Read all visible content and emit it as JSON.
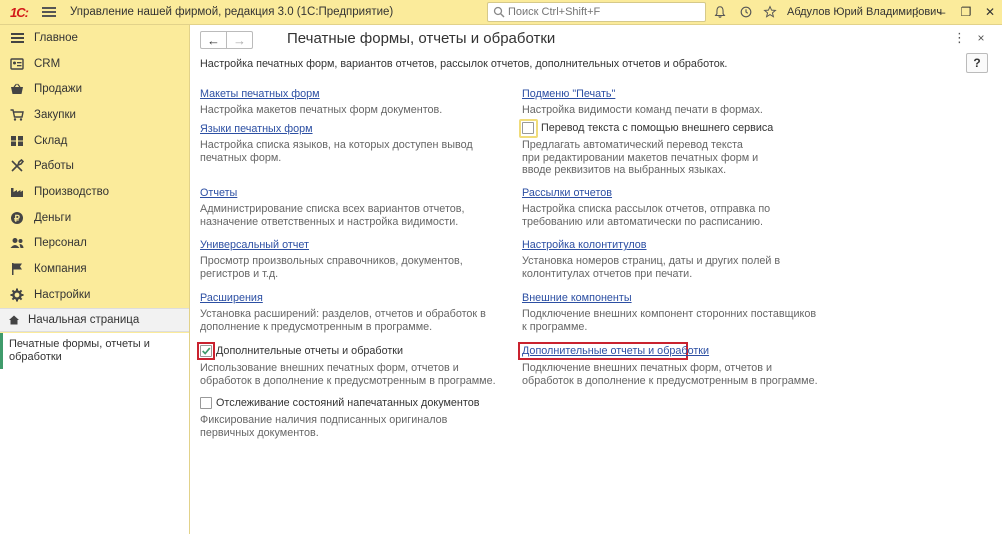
{
  "titlebar": {
    "logo": "1С:",
    "title": "Управление нашей фирмой, редакция 3.0  (1С:Предприятие)",
    "search_placeholder": "Поиск Ctrl+Shift+F",
    "user": "Абдулов Юрий Владимирович",
    "more": "⋮",
    "minimize": "‒",
    "restore": "❐",
    "close": "✕"
  },
  "sidebar": {
    "items": [
      {
        "label": "Главное",
        "icon": "menu-lines-icon"
      },
      {
        "label": "CRM",
        "icon": "crm-card-icon"
      },
      {
        "label": "Продажи",
        "icon": "basket-icon"
      },
      {
        "label": "Закупки",
        "icon": "cart-icon"
      },
      {
        "label": "Склад",
        "icon": "warehouse-icon"
      },
      {
        "label": "Работы",
        "icon": "tools-icon"
      },
      {
        "label": "Производство",
        "icon": "factory-icon"
      },
      {
        "label": "Деньги",
        "icon": "coin-icon"
      },
      {
        "label": "Персонал",
        "icon": "people-icon"
      },
      {
        "label": "Компания",
        "icon": "flag-icon"
      },
      {
        "label": "Настройки",
        "icon": "gear-icon"
      }
    ],
    "start_page": "Начальная страница",
    "open_form": "Печатные формы, отчеты и обработки"
  },
  "main": {
    "title": "Печатные формы, отчеты и обработки",
    "back": "←",
    "forward": "→",
    "more": "⋮",
    "close": "×",
    "help": "?",
    "description": "Настройка печатных форм, вариантов отчетов, рассылок отчетов, дополнительных отчетов и обработок.",
    "left": {
      "print_templates_link": "Макеты печатных форм",
      "print_templates_desc": "Настройка макетов печатных форм документов.",
      "print_languages_link": "Языки печатных форм",
      "print_languages_desc": "Настройка списка языков, на которых доступен вывод печатных форм.",
      "reports_link": "Отчеты",
      "reports_desc": "Администрирование списка всех вариантов отчетов, назначение ответственных и настройка видимости.",
      "universal_report_link": "Универсальный отчет",
      "universal_report_desc": "Просмотр произвольных справочников, документов, регистров и т.д.",
      "extensions_link": "Расширения",
      "extensions_desc": "Установка расширений: разделов, отчетов и обработок в дополнение к предусмотренным в программе.",
      "additional_reports_label": "Дополнительные отчеты и обработки",
      "additional_reports_checked": true,
      "additional_reports_desc": "Использование внешних печатных форм, отчетов и обработок в дополнение к предусмотренным в программе.",
      "tracking_label": "Отслеживание состояний напечатанных документов",
      "tracking_checked": false,
      "tracking_desc": "Фиксирование наличия подписанных оригиналов первичных документов."
    },
    "right": {
      "print_substitute_link": "Подменю \"Печать\"",
      "print_substitute_desc": "Настройка видимости команд печати в формах.",
      "translate_label": "Перевод текста с помощью внешнего сервиса",
      "translate_checked": false,
      "translate_desc": "Предлагать автоматический перевод текста при редактировании макетов печатных форм и вводе реквизитов на выбранных языках.",
      "mailings_link": "Рассылки отчетов",
      "mailings_desc": "Настройка списка рассылок отчетов, отправка по требованию или автоматически по расписанию.",
      "headers_link": "Настройка колонтитулов",
      "headers_desc": "Установка номеров страниц, даты и других полей в колонтитулах отчетов при печати.",
      "external_components_link": "Внешние компоненты",
      "external_components_desc": "Подключение внешних компонент сторонних поставщиков к программе.",
      "additional_reports_link": "Дополнительные отчеты и обработки",
      "additional_reports_desc": "Подключение внешних печатных форм, отчетов и обработок в дополнение к предусмотренным в программе."
    }
  },
  "colors": {
    "panel_yellow": "#fbeb9b",
    "link_blue": "#2c4fa3",
    "highlight_red": "#c9222f",
    "check_green": "#3f9b6b"
  }
}
